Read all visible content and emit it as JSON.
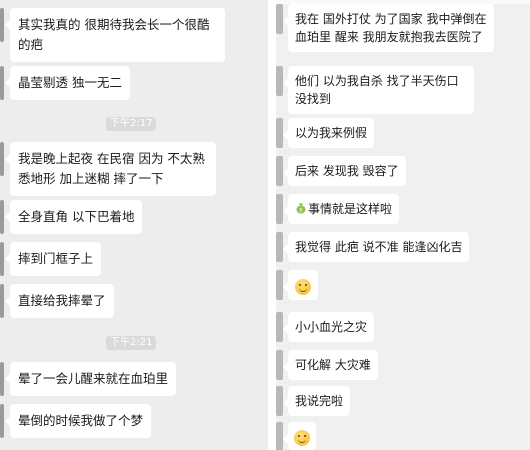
{
  "left_chat": {
    "messages": [
      "其实我真的 很期待我会长一个很酷的疤",
      "晶莹剔透 独一无二",
      "我是晚上起夜 在民宿 因为 不太熟悉地形 加上迷糊 摔了一下",
      "全身直角 以下巴着地",
      "摔到门框子上",
      "直接给我摔晕了",
      "晕了一会儿醒来就在血珀里",
      "晕倒的时候我做了个梦"
    ],
    "timestamps": [
      "下午2:17",
      "下午2:21"
    ]
  },
  "right_chat": {
    "messages": [
      "我在 国外打仗 为了国家 我中弹倒在血珀里 醒来 我朋友就抱我去医院了",
      "他们 以为我自杀 找了半天伤口 没找到",
      "以为我来例假",
      "后来 发现我 毁容了",
      "事情就是这样啦",
      "我觉得 此疤 说不准 能逢凶化吉",
      "小小血光之灾",
      "可化解 大灾难",
      "我说完啦"
    ],
    "icons": {
      "money_bag": "money-bag-icon",
      "face_1": "grinning-face-icon",
      "face_2": "smiling-face-icon"
    }
  },
  "colors": {
    "chat_background": "#ededed",
    "bubble": "#ffffff",
    "timestamp_pill": "#dadada"
  }
}
